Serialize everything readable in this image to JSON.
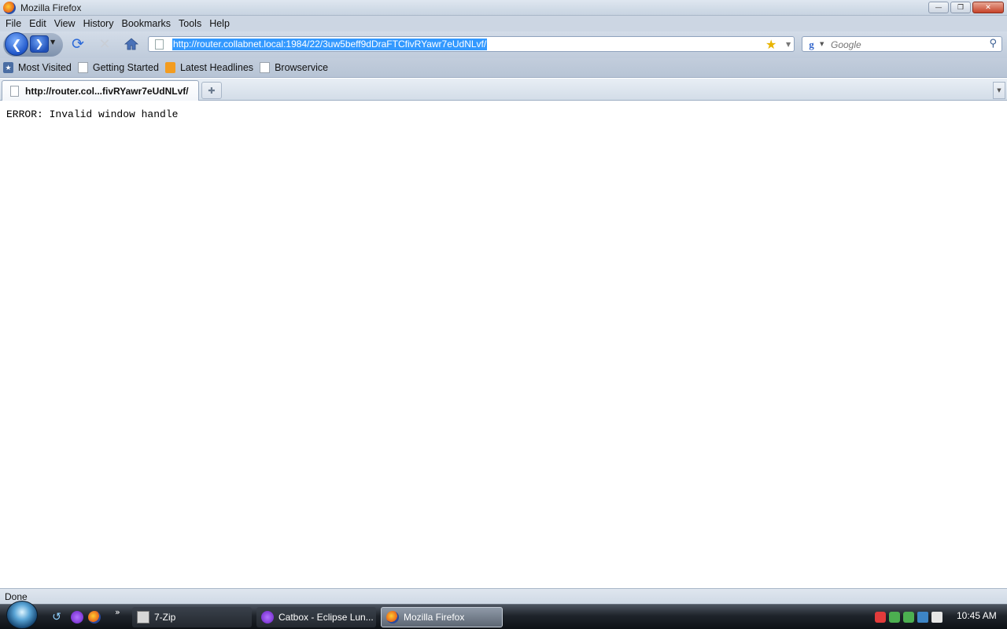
{
  "window": {
    "title": "Mozilla Firefox"
  },
  "menu": [
    "File",
    "Edit",
    "View",
    "History",
    "Bookmarks",
    "Tools",
    "Help"
  ],
  "nav": {
    "url": "http://router.collabnet.local:1984/22/3uw5beff9dDraFTCfivRYawr7eUdNLvf/",
    "search_placeholder": "Google"
  },
  "bookmarks": [
    "Most Visited",
    "Getting Started",
    "Latest Headlines",
    "Browservice"
  ],
  "tabs": [
    {
      "label": "http://router.col...fivRYawr7eUdNLvf/"
    }
  ],
  "page": {
    "error": "ERROR: Invalid window handle"
  },
  "status": {
    "text": "Done"
  },
  "taskbar": {
    "tasks": [
      "7-Zip",
      "Catbox - Eclipse Lun...",
      "Mozilla Firefox"
    ],
    "more": "»",
    "clock": "10:45 AM"
  },
  "colors": {
    "url_highlight": "#3399ff",
    "title_bg": "#c7d3e1",
    "taskbar_bg": "#1f242b"
  },
  "icons": [
    "firefox-icon",
    "back-icon",
    "forward-icon",
    "reload-icon",
    "stop-icon",
    "home-icon",
    "star-icon",
    "google-icon",
    "search-icon",
    "page-icon",
    "rss-icon",
    "windows-start-icon"
  ]
}
